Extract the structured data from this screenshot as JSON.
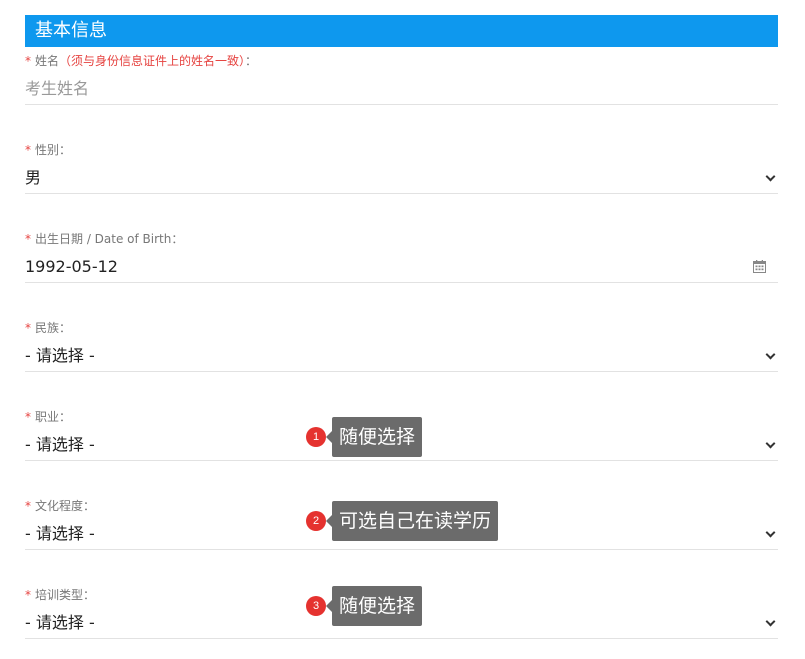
{
  "section": {
    "title": "基本信息"
  },
  "fields": {
    "name": {
      "required": "*",
      "label": "姓名",
      "note": "（须与身份信息证件上的姓名一致）",
      "suffix": "：",
      "placeholder": "考生姓名"
    },
    "gender": {
      "required": "*",
      "label": "性别：",
      "value": "男"
    },
    "birth": {
      "required": "*",
      "label": "出生日期 / Date of Birth：",
      "value": "1992-05-12"
    },
    "ethnicity": {
      "required": "*",
      "label": "民族：",
      "value": "- 请选择 -"
    },
    "occupation": {
      "required": "*",
      "label": "职业：",
      "value": "- 请选择 -"
    },
    "education": {
      "required": "*",
      "label": "文化程度：",
      "value": "- 请选择 -"
    },
    "training_type": {
      "required": "*",
      "label": "培训类型：",
      "value": "- 请选择 -"
    }
  },
  "annotations": [
    {
      "number": "1",
      "text": "随便选择"
    },
    {
      "number": "2",
      "text": "可选自己在读学历"
    },
    {
      "number": "3",
      "text": "随便选择"
    }
  ],
  "icons": {
    "dropdown": "chevron-down-icon",
    "calendar": "calendar-icon"
  },
  "colors": {
    "header_bg": "#0e98ee",
    "required": "#e64340",
    "badge": "#e5322f",
    "tooltip_bg": "#6b6b6b"
  }
}
